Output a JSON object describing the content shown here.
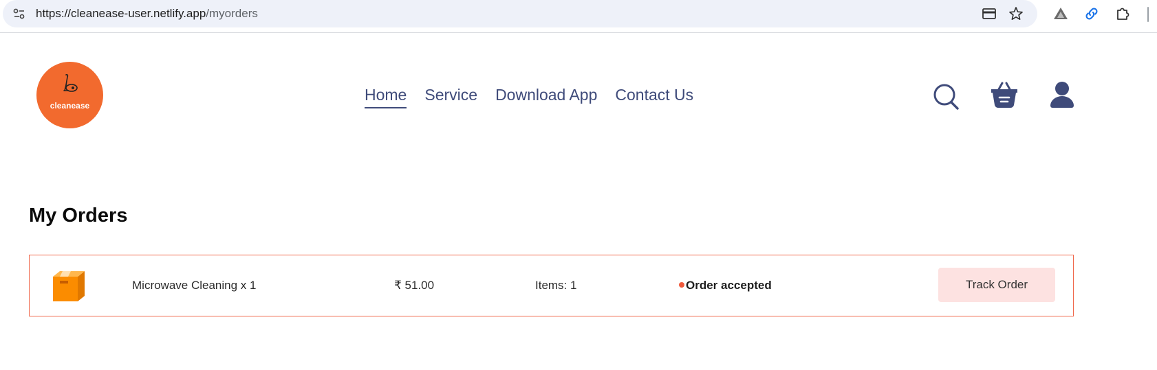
{
  "browser": {
    "url_base": "https://cleanease-user.netlify.app",
    "url_path": "/myorders",
    "icons": [
      "site-info-icon",
      "card-icon",
      "bookmark-star-icon",
      "extension-a-icon",
      "link-icon",
      "puzzle-icon"
    ]
  },
  "header": {
    "logo_text": "cleanease",
    "nav": [
      {
        "label": "Home",
        "active": true
      },
      {
        "label": "Service",
        "active": false
      },
      {
        "label": "Download App",
        "active": false
      },
      {
        "label": "Contact Us",
        "active": false
      }
    ],
    "icons": [
      "search-icon",
      "basket-icon",
      "user-icon"
    ]
  },
  "page": {
    "title": "My Orders"
  },
  "orders": [
    {
      "name": "Microwave Cleaning x 1",
      "price": "₹ 51.00",
      "items": "Items: 1",
      "status": "Order accepted",
      "action": "Track Order"
    }
  ],
  "colors": {
    "brand_orange": "#f26a2e",
    "nav_text": "#3f4b7a",
    "card_border": "#f0674a",
    "button_bg": "#fde2e1",
    "status_dot": "#f05a3c"
  }
}
